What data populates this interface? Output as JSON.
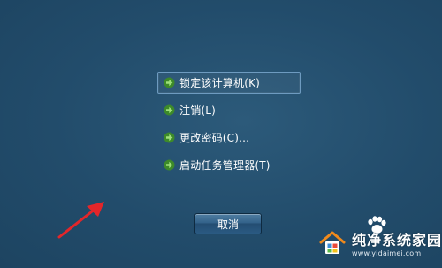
{
  "menu": {
    "items": [
      {
        "label": "锁定该计算机(K)",
        "name": "menu-item-lock-computer"
      },
      {
        "label": "注销(L)",
        "name": "menu-item-log-off"
      },
      {
        "label": "更改密码(C)...",
        "name": "menu-item-change-password"
      },
      {
        "label": "启动任务管理器(T)",
        "name": "menu-item-start-task-manager"
      }
    ],
    "item_icon": "green-arrow-icon"
  },
  "cancel_button": {
    "label": "取消"
  },
  "watermark": {
    "title": "纯净系统家园",
    "url": "www.yidaimei.com"
  },
  "colors": {
    "background": "#224c6b",
    "arrow_green": "#5fbf3c",
    "annotation_red": "#e3262a",
    "focus_border": "#6e9bc0"
  }
}
